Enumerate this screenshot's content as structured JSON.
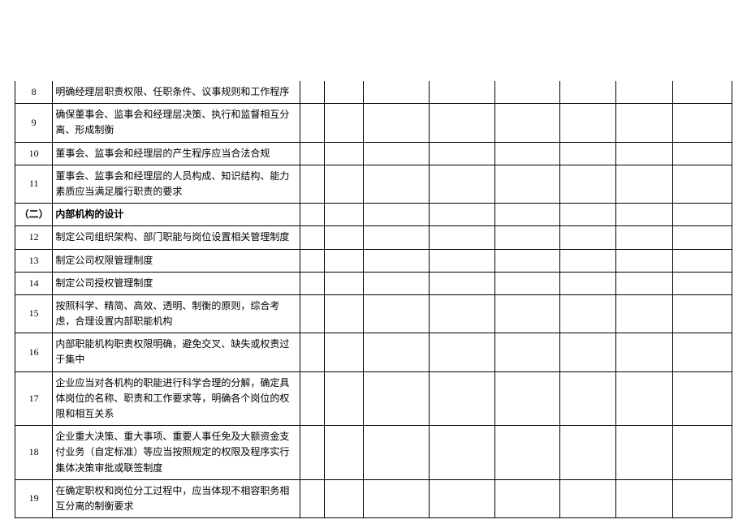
{
  "rows": [
    {
      "num": "8",
      "desc": "明确经理层职责权限、任职条件、议事规则和工作程序",
      "section": false
    },
    {
      "num": "9",
      "desc": "确保董事会、监事会和经理层决策、执行和监督相互分离、形成制衡",
      "section": false
    },
    {
      "num": "10",
      "desc": "董事会、监事会和经理层的产生程序应当合法合规",
      "section": false
    },
    {
      "num": "11",
      "desc": "董事会、监事会和经理层的人员构成、知识结构、能力素质应当满足履行职责的要求",
      "section": false
    },
    {
      "num": "（二）",
      "desc": "内部机构的设计",
      "section": true
    },
    {
      "num": "12",
      "desc": "制定公司组织架构、部门职能与岗位设置相关管理制度",
      "section": false
    },
    {
      "num": "13",
      "desc": "制定公司权限管理制度",
      "section": false
    },
    {
      "num": "14",
      "desc": "制定公司授权管理制度",
      "section": false
    },
    {
      "num": "15",
      "desc": "按照科学、精简、高效、透明、制衡的原则，综合考虑，合理设置内部职能机构",
      "section": false
    },
    {
      "num": "16",
      "desc": "内部职能机构职责权限明确，避免交叉、缺失或权责过于集中",
      "section": false
    },
    {
      "num": "17",
      "desc": "企业应当对各机构的职能进行科学合理的分解，确定具体岗位的名称、职责和工作要求等，明确各个岗位的权限和相互关系",
      "section": false
    },
    {
      "num": "18",
      "desc": "企业重大决策、重大事项、重要人事任免及大额资金支付业务（自定标准）等应当按照规定的权限及程序实行集体决策审批或联签制度",
      "section": false
    },
    {
      "num": "19",
      "desc": "在确定职权和岗位分工过程中，应当体现不相容职务相互分离的制衡要求",
      "section": false
    }
  ]
}
